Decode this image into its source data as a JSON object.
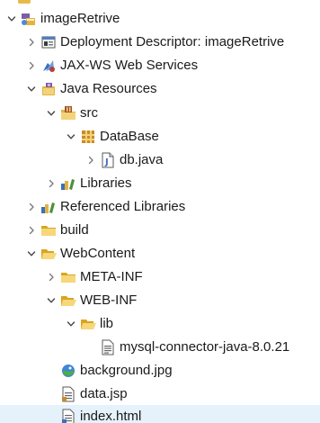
{
  "tree": [
    {
      "name": "project-imageRetrive",
      "label": "imageRetrive",
      "depth": 0,
      "expanded": true,
      "icon": "project-icon"
    },
    {
      "name": "deployment-descriptor",
      "label": "Deployment Descriptor: imageRetrive",
      "depth": 1,
      "expanded": false,
      "icon": "deployment-descriptor-icon"
    },
    {
      "name": "jax-ws-web-services",
      "label": "JAX-WS Web Services",
      "depth": 1,
      "expanded": false,
      "icon": "web-services-icon"
    },
    {
      "name": "java-resources",
      "label": "Java Resources",
      "depth": 1,
      "expanded": true,
      "icon": "java-resources-icon"
    },
    {
      "name": "src-folder",
      "label": "src",
      "depth": 2,
      "expanded": true,
      "icon": "source-folder-icon"
    },
    {
      "name": "package-DataBase",
      "label": "DataBase",
      "depth": 3,
      "expanded": true,
      "icon": "package-icon"
    },
    {
      "name": "file-db-java",
      "label": "db.java",
      "depth": 4,
      "expanded": false,
      "icon": "java-file-icon"
    },
    {
      "name": "libraries",
      "label": "Libraries",
      "depth": 2,
      "expanded": false,
      "icon": "libraries-icon"
    },
    {
      "name": "referenced-libraries",
      "label": "Referenced Libraries",
      "depth": 1,
      "expanded": false,
      "icon": "libraries-icon"
    },
    {
      "name": "folder-build",
      "label": "build",
      "depth": 1,
      "expanded": false,
      "icon": "folder-icon"
    },
    {
      "name": "folder-WebContent",
      "label": "WebContent",
      "depth": 1,
      "expanded": true,
      "icon": "folder-open-icon"
    },
    {
      "name": "folder-META-INF",
      "label": "META-INF",
      "depth": 2,
      "expanded": false,
      "icon": "folder-icon"
    },
    {
      "name": "folder-WEB-INF",
      "label": "WEB-INF",
      "depth": 2,
      "expanded": true,
      "icon": "folder-open-icon"
    },
    {
      "name": "folder-lib",
      "label": "lib",
      "depth": 3,
      "expanded": true,
      "icon": "folder-open-icon"
    },
    {
      "name": "file-mysql-connector",
      "label": "mysql-connector-java-8.0.21",
      "depth": 4,
      "leaf": true,
      "icon": "jar-file-icon"
    },
    {
      "name": "file-background-jpg",
      "label": "background.jpg",
      "depth": 2,
      "leaf": true,
      "icon": "image-file-icon"
    },
    {
      "name": "file-data-jsp",
      "label": "data.jsp",
      "depth": 2,
      "leaf": true,
      "icon": "jsp-file-icon"
    },
    {
      "name": "file-index-html",
      "label": "index.html",
      "depth": 2,
      "leaf": true,
      "selected": true,
      "icon": "html-file-icon"
    }
  ]
}
